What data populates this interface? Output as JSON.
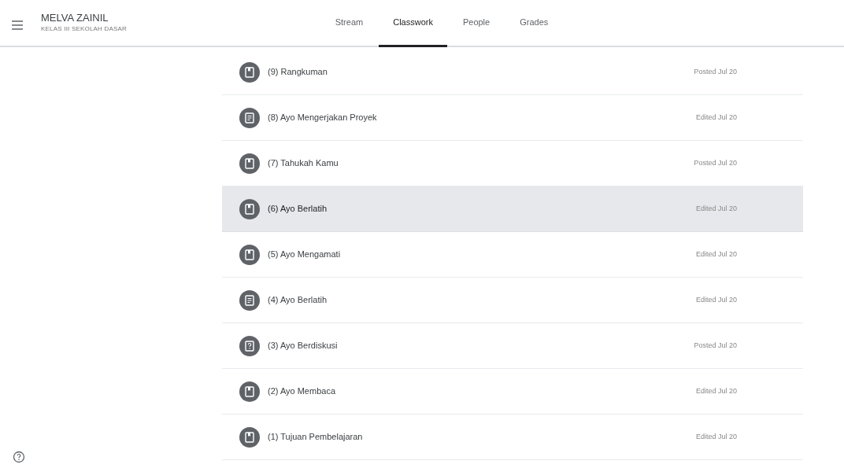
{
  "header": {
    "class_name": "MELVA ZAINIL",
    "class_section": "KELAS III SEKOLAH DASAR"
  },
  "tabs": [
    {
      "label": "Stream",
      "selected": false
    },
    {
      "label": "Classwork",
      "selected": true
    },
    {
      "label": "People",
      "selected": false
    },
    {
      "label": "Grades",
      "selected": false
    }
  ],
  "items": [
    {
      "kind": "material",
      "title": "(9) Rangkuman",
      "date": "Posted Jul 20",
      "selected": false
    },
    {
      "kind": "assignment",
      "title": "(8) Ayo Mengerjakan Proyek",
      "date": "Edited Jul 20",
      "selected": false
    },
    {
      "kind": "material",
      "title": "(7) Tahukah Kamu",
      "date": "Posted Jul 20",
      "selected": false
    },
    {
      "kind": "material",
      "title": "(6) Ayo Berlatih",
      "date": "Edited Jul 20",
      "selected": true
    },
    {
      "kind": "material",
      "title": "(5) Ayo Mengamati",
      "date": "Edited Jul 20",
      "selected": false
    },
    {
      "kind": "assignment",
      "title": "(4) Ayo Berlatih",
      "date": "Edited Jul 20",
      "selected": false
    },
    {
      "kind": "question",
      "title": "(3) Ayo Berdiskusi",
      "date": "Posted Jul 20",
      "selected": false
    },
    {
      "kind": "material",
      "title": "(2) Ayo Membaca",
      "date": "Edited Jul 20",
      "selected": false
    },
    {
      "kind": "material",
      "title": "(1) Tujuan Pembelajaran",
      "date": "Edited Jul 20",
      "selected": false
    }
  ]
}
